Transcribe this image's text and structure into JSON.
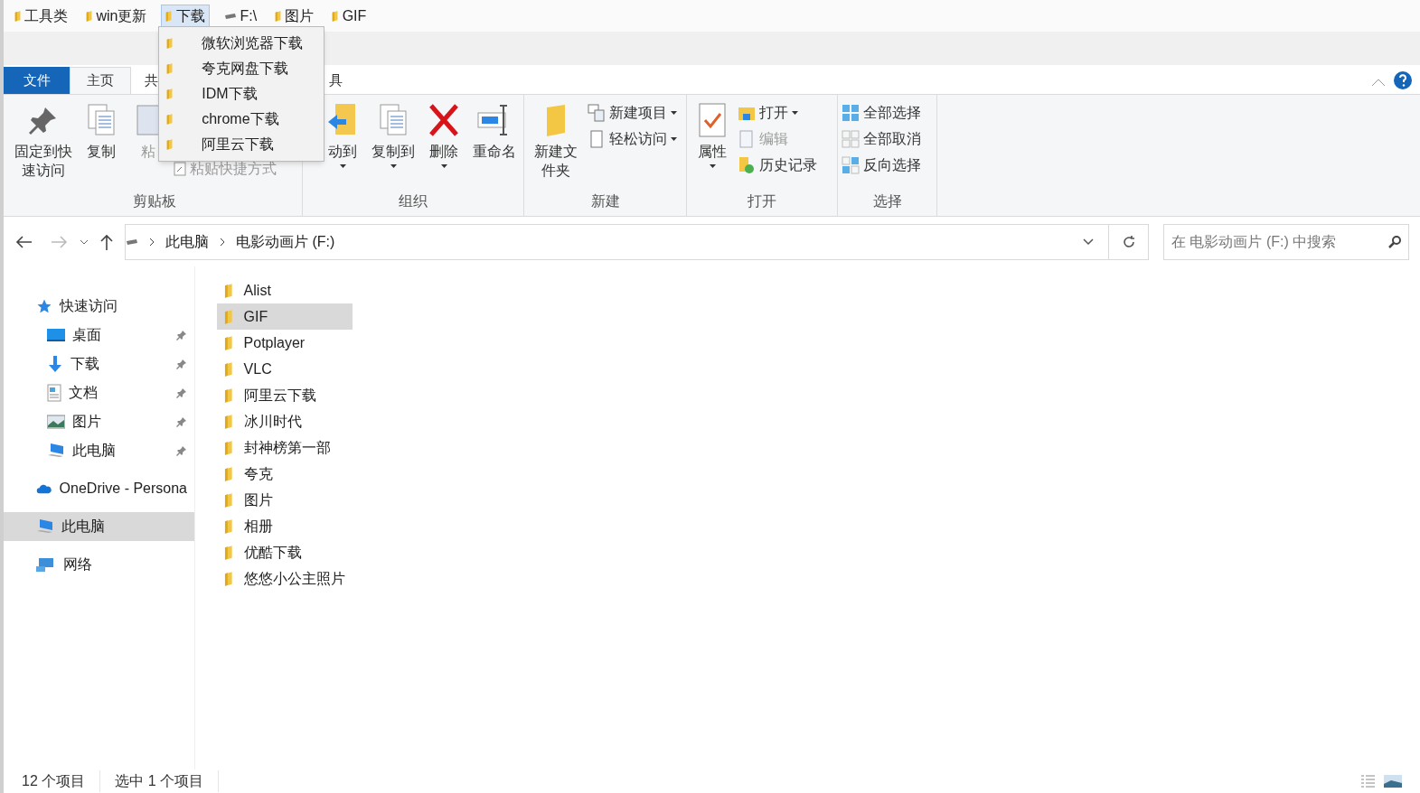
{
  "bookmarks": [
    {
      "label": "工具类",
      "kind": "folder",
      "selected": false
    },
    {
      "label": "win更新",
      "kind": "folder",
      "selected": false
    },
    {
      "label": "下载",
      "kind": "folder",
      "selected": true
    },
    {
      "label": "F:\\",
      "kind": "drive",
      "selected": false
    },
    {
      "label": "图片",
      "kind": "folder",
      "selected": false
    },
    {
      "label": "GIF",
      "kind": "folder",
      "selected": false
    }
  ],
  "bookmark_menu": [
    "微软浏览器下载",
    "夸克网盘下载",
    "IDM下载",
    "chrome下载",
    "阿里云下载"
  ],
  "ribbon_tabs": [
    {
      "label": "文件",
      "kind": "file",
      "selected": false
    },
    {
      "label": "主页",
      "kind": "tab",
      "selected": true
    },
    {
      "label": "共",
      "kind": "tab",
      "selected": false
    },
    {
      "label": "具",
      "kind": "tab",
      "selected": false
    }
  ],
  "ribbon_groups": [
    {
      "title": "剪贴板",
      "commands": [
        {
          "label": "固定到快速访问",
          "kind": "large",
          "dropdown": false,
          "disabled": false
        },
        {
          "label": "复制",
          "kind": "large",
          "dropdown": false,
          "disabled": false
        },
        {
          "label": "粘",
          "kind": "large",
          "dropdown": false,
          "disabled": true
        },
        {
          "label": "粘贴快捷方式",
          "kind": "small",
          "dropdown": false,
          "disabled": true
        }
      ]
    },
    {
      "title": "组织",
      "commands": [
        {
          "label": "动到",
          "kind": "large",
          "dropdown": true,
          "disabled": false
        },
        {
          "label": "复制到",
          "kind": "large",
          "dropdown": true,
          "disabled": false
        },
        {
          "label": "删除",
          "kind": "large",
          "dropdown": true,
          "disabled": false
        },
        {
          "label": "重命名",
          "kind": "large",
          "dropdown": false,
          "disabled": false
        }
      ]
    },
    {
      "title": "新建",
      "commands": [
        {
          "label": "新建文件夹",
          "kind": "large",
          "dropdown": false,
          "disabled": false
        },
        {
          "label": "新建项目",
          "kind": "small",
          "dropdown": true,
          "disabled": false
        },
        {
          "label": "轻松访问",
          "kind": "small",
          "dropdown": true,
          "disabled": false
        }
      ]
    },
    {
      "title": "打开",
      "commands": [
        {
          "label": "属性",
          "kind": "large",
          "dropdown": true,
          "disabled": false
        },
        {
          "label": "打开",
          "kind": "small",
          "dropdown": true,
          "disabled": false
        },
        {
          "label": "编辑",
          "kind": "small",
          "dropdown": false,
          "disabled": true
        },
        {
          "label": "历史记录",
          "kind": "small",
          "dropdown": false,
          "disabled": false
        }
      ]
    },
    {
      "title": "选择",
      "commands": [
        {
          "label": "全部选择",
          "kind": "small",
          "dropdown": false,
          "disabled": false
        },
        {
          "label": "全部取消",
          "kind": "small",
          "dropdown": false,
          "disabled": false
        },
        {
          "label": "反向选择",
          "kind": "small",
          "dropdown": false,
          "disabled": false
        }
      ]
    }
  ],
  "address": {
    "path": [
      "此电脑",
      "电影动画片 (F:)"
    ],
    "search_placeholder": "在 电影动画片 (F:) 中搜索"
  },
  "nav_pane": [
    {
      "label": "快速访问",
      "kind": "star",
      "selected": false,
      "pinned": false,
      "children": [
        {
          "label": "桌面",
          "kind": "desktop",
          "selected": false,
          "pinned": true
        },
        {
          "label": "下载",
          "kind": "download",
          "selected": false,
          "pinned": true
        },
        {
          "label": "文档",
          "kind": "document",
          "selected": false,
          "pinned": true
        },
        {
          "label": "图片",
          "kind": "pictures",
          "selected": false,
          "pinned": true
        },
        {
          "label": "此电脑",
          "kind": "computer",
          "selected": false,
          "pinned": true
        }
      ]
    },
    {
      "label": "OneDrive - Persona",
      "kind": "cloud",
      "selected": false,
      "pinned": false
    },
    {
      "label": "此电脑",
      "kind": "computer",
      "selected": true,
      "pinned": false
    },
    {
      "label": "网络",
      "kind": "network",
      "selected": false,
      "pinned": false
    }
  ],
  "files": [
    {
      "name": "Alist",
      "selected": false
    },
    {
      "name": "GIF",
      "selected": true
    },
    {
      "name": "Potplayer",
      "selected": false
    },
    {
      "name": "VLC",
      "selected": false
    },
    {
      "name": "阿里云下载",
      "selected": false
    },
    {
      "name": "冰川时代",
      "selected": false
    },
    {
      "name": "封神榜第一部",
      "selected": false
    },
    {
      "name": "夸克",
      "selected": false
    },
    {
      "name": "图片",
      "selected": false
    },
    {
      "name": "相册",
      "selected": false
    },
    {
      "name": "优酷下载",
      "selected": false
    },
    {
      "name": "悠悠小公主照片",
      "selected": false
    }
  ],
  "status_bar": {
    "item_count": "12 个项目",
    "selection": "选中 1 个项目"
  }
}
